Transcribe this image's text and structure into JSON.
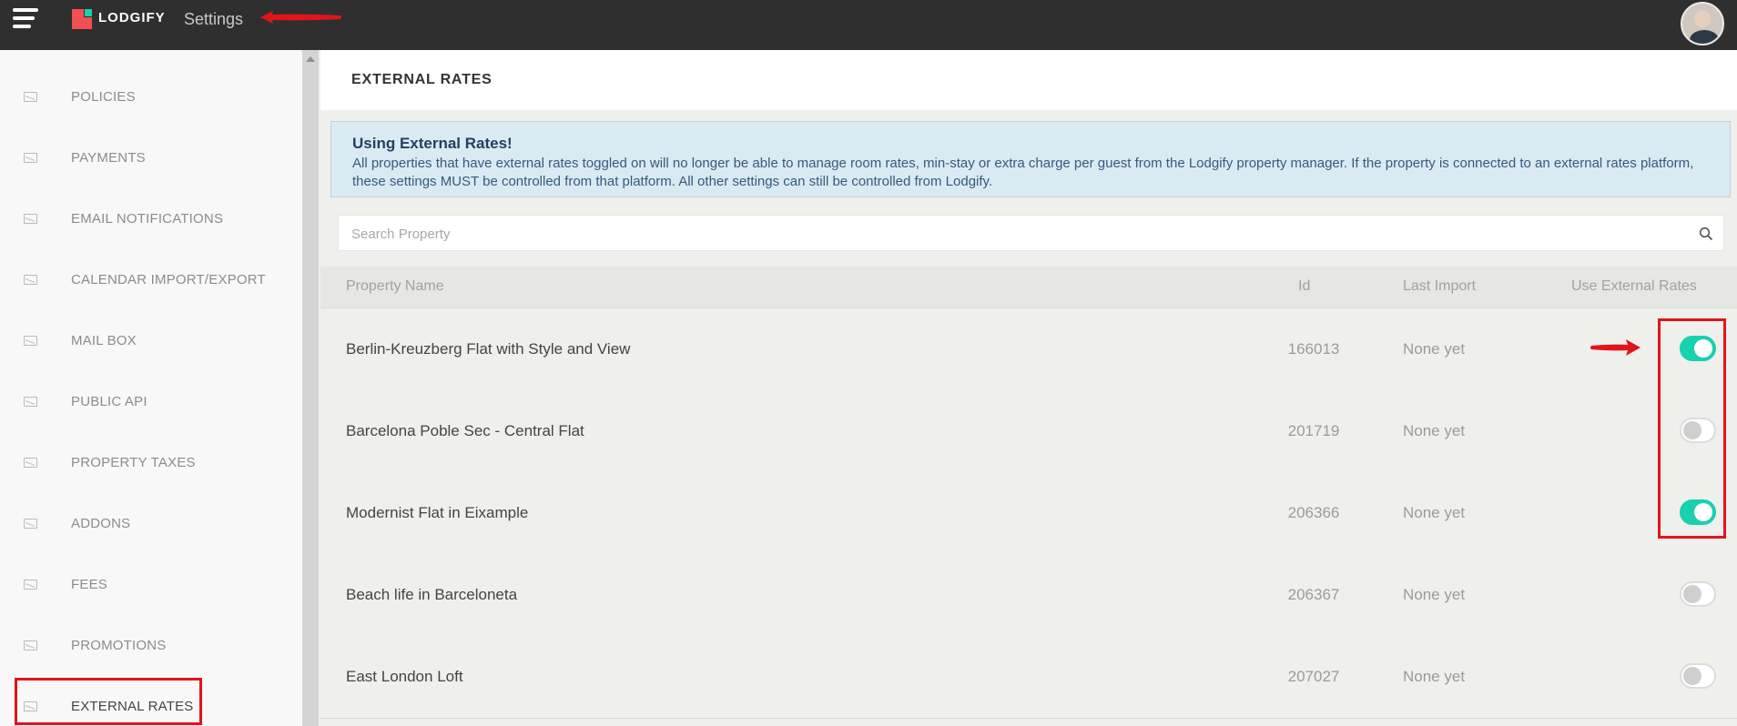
{
  "topbar": {
    "brand": "LODGIFY",
    "title": "Settings",
    "menu_icon": "hamburger-menu-icon",
    "avatar": "user-avatar"
  },
  "sidebar": {
    "items": [
      {
        "label": "POLICIES",
        "icon": "policies-icon"
      },
      {
        "label": "PAYMENTS",
        "icon": "payments-icon"
      },
      {
        "label": "EMAIL NOTIFICATIONS",
        "icon": "envelope-icon"
      },
      {
        "label": "CALENDAR IMPORT/EXPORT",
        "icon": "calendar-icon"
      },
      {
        "label": "MAIL BOX",
        "icon": "envelope-icon"
      },
      {
        "label": "PUBLIC API",
        "icon": "envelope-icon"
      },
      {
        "label": "PROPERTY TAXES",
        "icon": "envelope-icon"
      },
      {
        "label": "ADDONS",
        "icon": "envelope-icon"
      },
      {
        "label": "FEES",
        "icon": "envelope-icon"
      },
      {
        "label": "PROMOTIONS",
        "icon": "envelope-icon"
      },
      {
        "label": "EXTERNAL RATES",
        "icon": "envelope-icon",
        "active": true
      }
    ]
  },
  "main": {
    "title": "EXTERNAL RATES",
    "info": {
      "title": "Using External Rates!",
      "text": "All properties that have external rates toggled on will no longer be able to manage room rates, min-stay or extra charge per guest from the Lodgify property manager. If the property is connected to an external rates platform, these settings MUST be controlled from that platform. All other settings can still be controlled from Lodgify."
    },
    "search": {
      "placeholder": "Search Property",
      "icon": "search-icon"
    },
    "table": {
      "headers": {
        "name": "Property Name",
        "id": "Id",
        "last_import": "Last Import",
        "use_external": "Use External Rates"
      },
      "rows": [
        {
          "name": "Berlin-Kreuzberg Flat with Style and View",
          "id": "166013",
          "last_import": "None yet",
          "enabled": true
        },
        {
          "name": "Barcelona Poble Sec - Central Flat",
          "id": "201719",
          "last_import": "None yet",
          "enabled": false
        },
        {
          "name": "Modernist Flat in Eixample",
          "id": "206366",
          "last_import": "None yet",
          "enabled": true
        },
        {
          "name": "Beach life in Barceloneta",
          "id": "206367",
          "last_import": "None yet",
          "enabled": false
        },
        {
          "name": "East London Loft",
          "id": "207027",
          "last_import": "None yet",
          "enabled": false
        }
      ]
    }
  },
  "colors": {
    "topbar": "#2f2f2f",
    "accent_toggle": "#18d1ae",
    "annotation": "#e0151a",
    "brand_red": "#f0504f"
  }
}
